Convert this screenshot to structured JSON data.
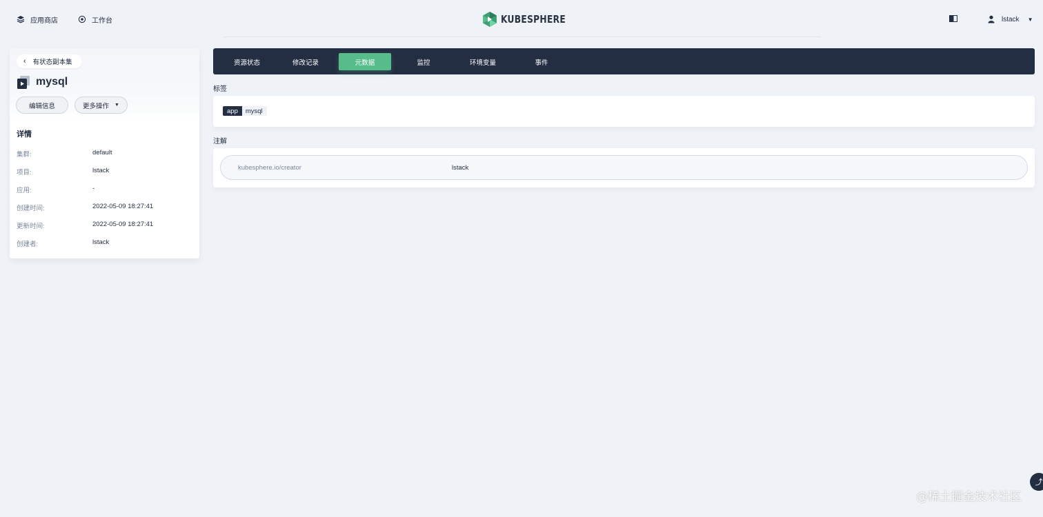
{
  "header": {
    "nav": [
      {
        "label": "应用商店",
        "icon": "app-store-icon"
      },
      {
        "label": "工作台",
        "icon": "workbench-icon"
      }
    ],
    "logo_text": "KUBESPHERE",
    "user": {
      "name": "lstack",
      "icon": "user-icon"
    },
    "theme_icon": "theme-toggle-icon"
  },
  "resource": {
    "back_label": "有状态副本集",
    "name": "mysql",
    "edit_button": "编辑信息",
    "more_button": "更多操作",
    "details_title": "详情",
    "details": [
      {
        "key": "集群:",
        "value": "default"
      },
      {
        "key": "项目:",
        "value": "lstack"
      },
      {
        "key": "应用:",
        "value": "-"
      },
      {
        "key": "创建时间:",
        "value": "2022-05-09 18:27:41"
      },
      {
        "key": "更新时间:",
        "value": "2022-05-09 18:27:41"
      },
      {
        "key": "创建者:",
        "value": "lstack"
      }
    ]
  },
  "tabs": [
    {
      "label": "资源状态",
      "active": false
    },
    {
      "label": "修改记录",
      "active": false
    },
    {
      "label": "元数据",
      "active": true
    },
    {
      "label": "监控",
      "active": false
    },
    {
      "label": "环境变量",
      "active": false
    },
    {
      "label": "事件",
      "active": false
    }
  ],
  "labels_section": {
    "title": "标签",
    "tags": [
      {
        "key": "app",
        "value": "mysql"
      }
    ]
  },
  "annotations_section": {
    "title": "注解",
    "items": [
      {
        "key": "kubesphere.io/creator",
        "value": "lstack"
      }
    ]
  },
  "watermark": "@稀土掘金技术社区",
  "colors": {
    "accent": "#55bc8a",
    "dark": "#242e42",
    "background": "#eff2f7",
    "muted_text": "#79879c"
  }
}
